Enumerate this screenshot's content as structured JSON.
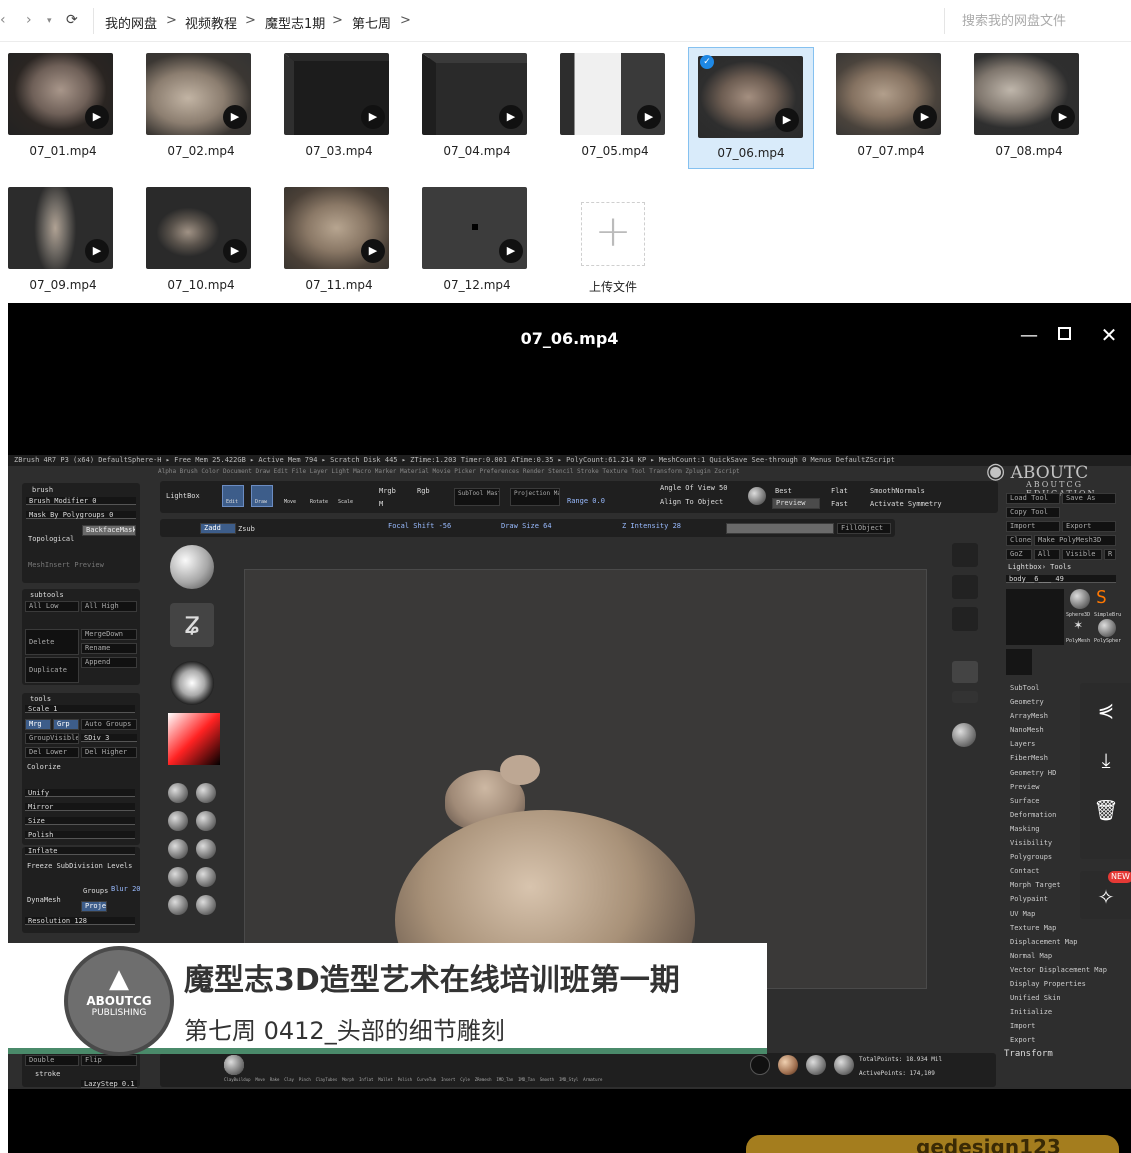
{
  "breadcrumbs": [
    "我的网盘",
    "视频教程",
    "魔型志1期",
    "第七周"
  ],
  "search": {
    "placeholder": "搜索我的网盘文件"
  },
  "files": [
    {
      "name": "07_01.mp4",
      "selected": false
    },
    {
      "name": "07_02.mp4",
      "selected": false
    },
    {
      "name": "07_03.mp4",
      "selected": false
    },
    {
      "name": "07_04.mp4",
      "selected": false
    },
    {
      "name": "07_05.mp4",
      "selected": false
    },
    {
      "name": "07_06.mp4",
      "selected": true
    },
    {
      "name": "07_07.mp4",
      "selected": false
    },
    {
      "name": "07_08.mp4",
      "selected": false
    },
    {
      "name": "07_09.mp4",
      "selected": false
    },
    {
      "name": "07_10.mp4",
      "selected": false
    },
    {
      "name": "07_11.mp4",
      "selected": false
    },
    {
      "name": "07_12.mp4",
      "selected": false
    }
  ],
  "upload": {
    "label": "上传文件"
  },
  "player": {
    "title": "07_06.mp4",
    "overlay_title": "魔型志3D造型艺术在线培训班第一期",
    "overlay_subtitle": "第七周 0412_头部的细节雕刻",
    "logo_line1": "ABOUTCG",
    "logo_line2": "PUBLISHING",
    "new_badge": "NEW",
    "watermark": "ABOUTCG EDUCATION",
    "footer_watermark": "gedesign123"
  },
  "zbrush": {
    "topbar": "ZBrush 4R7 P3 (x64)   DefaultSphere-H   ▸ Free Mem 25.422GB ▸ Active Mem 794 ▸ Scratch Disk 445 ▸ ZTime:1.203 Timer:0.001 ATime:0.35 ▸ PolyCount:61.214 KP ▸ MeshCount:1      QuickSave   See-through 0   Menus  DefaultZScript",
    "menu": "Alpha  Brush  Color  Document  Draw  Edit  File  Layer  Light  Macro  Marker  Material  Movie  Picker  Preferences  Render  Stencil  Stroke  Texture  Tool  Transform  Zplugin  Zscript",
    "tools": [
      "Edit",
      "Draw",
      "Move",
      "Rotate",
      "Scale"
    ],
    "lightbox": "LightBox",
    "mrgb": "Mrgb",
    "rgb": "Rgb",
    "m": "M",
    "zadd": "Zadd",
    "zsub": "Zsub",
    "subtool_master": "SubTool Master",
    "projection_master": "Projection Master",
    "range": "Range 0.0",
    "angle": "Angle Of View 50",
    "align": "Align To Object",
    "best": "Best",
    "preview": "Preview",
    "flat": "Flat",
    "fast": "Fast",
    "smooth": "SmoothNormals",
    "sym": "Activate Symmetry",
    "focal": "Focal Shift -56",
    "drawsize": "Draw Size 64",
    "intensity": "Z Intensity 28",
    "fill": "FillObject",
    "left": {
      "brush": "brush",
      "brush_mod": "Brush Modifier 0",
      "mask": "Mask By Polygroups 0",
      "backface": "BackfaceMask",
      "topo": "Topological",
      "meshinsert": "MeshInsert Preview",
      "subtools": "subtools",
      "all_low": "All Low",
      "all_high": "All High",
      "delete": "Delete",
      "merge_down": "MergeDown",
      "rename": "Rename",
      "duplicate": "Duplicate",
      "append": "Append",
      "tools": "tools",
      "scale": "Scale 1",
      "mrg": "Mrg",
      "grp": "Grp",
      "auto_groups": "Auto Groups",
      "group_visible": "GroupVisible",
      "sdiv": "SDiv 3",
      "del_lower": "Del Lower",
      "del_higher": "Del Higher",
      "colorize": "Colorize",
      "unify": "Unify",
      "mirror": "Mirror",
      "size": "Size",
      "polish": "Polish",
      "inflate": "Inflate",
      "freeze": "Freeze SubDivision Levels",
      "dynamesh": "DynaMesh",
      "groups": "Groups",
      "blur": "Blur 20",
      "project": "Project",
      "resolution": "Resolution 128",
      "double": "Double",
      "flip": "Flip",
      "stroke": "stroke",
      "lazystep": "LazyStep 0.1"
    },
    "right": {
      "load_tool": "Load Tool",
      "save_as": "Save As",
      "copy_tool": "Copy Tool",
      "import": "Import",
      "export": "Export",
      "clone": "Clone",
      "make_poly": "Make PolyMesh3D",
      "goz": "GoZ",
      "all": "All",
      "visible": "Visible",
      "r": "R",
      "lightbox_tools": "Lightbox› Tools",
      "body": "body__6___ 49",
      "sphere3d": "Sphere3D",
      "simplebrush": "SimpleBru",
      "polymesh": "PolyMesh",
      "polysphere": "PolySpher",
      "menu": [
        "SubTool",
        "Geometry",
        "ArrayMesh",
        "NanoMesh",
        "Layers",
        "FiberMesh",
        "Geometry HD",
        "Preview",
        "Surface",
        "Deformation",
        "Masking",
        "Visibility",
        "Polygroups",
        "Contact",
        "Morph Target",
        "Polypaint",
        "UV Map",
        "Texture Map",
        "Displacement Map",
        "Normal Map",
        "Vector Displacement Map",
        "Display Properties",
        "Unified Skin",
        "Initialize",
        "Import",
        "Export"
      ],
      "transform": "Transform"
    },
    "shelf": [
      "ClayBuildup",
      "Move",
      "Rake",
      "Clay",
      "Pinch",
      "ClayTubes",
      "Morph",
      "Inflat",
      "Mallet",
      "Polish",
      "CurveTub",
      "Insert",
      "Cyle",
      "ZRemesh",
      "IMD_Tan",
      "IMD_Tan",
      "Smooth",
      "IMD_Styl",
      "Armature"
    ],
    "total_points": "TotalPoints: 18.934 Mil",
    "active_points": "ActivePoints: 174,109"
  }
}
